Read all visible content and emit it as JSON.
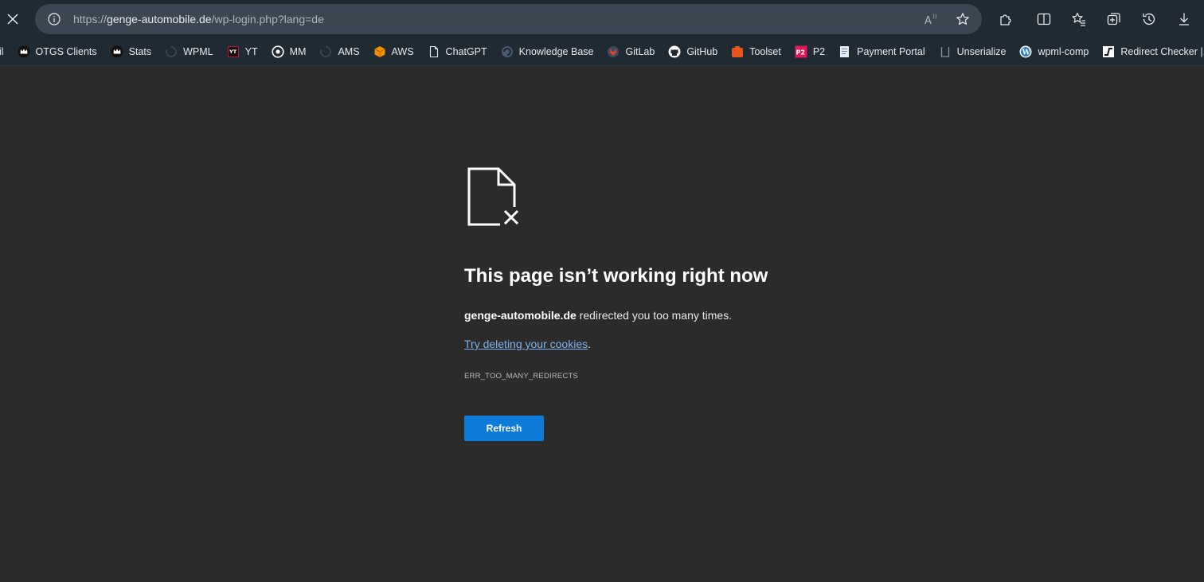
{
  "address_bar": {
    "url_host_prefix": "https://",
    "url_host": "genge-automobile.de",
    "url_path": "/wp-login.php?lang=de"
  },
  "bookmarks": [
    {
      "label": "ail",
      "icon": "mail-icon"
    },
    {
      "label": "OTGS Clients",
      "icon": "crown-icon"
    },
    {
      "label": "Stats",
      "icon": "crown-icon"
    },
    {
      "label": "WPML",
      "icon": "wpml-icon"
    },
    {
      "label": "YT",
      "icon": "yt-icon"
    },
    {
      "label": "MM",
      "icon": "mm-icon"
    },
    {
      "label": "AMS",
      "icon": "wpml-icon"
    },
    {
      "label": "AWS",
      "icon": "aws-cube-icon"
    },
    {
      "label": "ChatGPT",
      "icon": "page-icon"
    },
    {
      "label": "Knowledge Base",
      "icon": "kb-icon"
    },
    {
      "label": "GitLab",
      "icon": "gitlab-icon"
    },
    {
      "label": "GitHub",
      "icon": "github-icon"
    },
    {
      "label": "Toolset",
      "icon": "toolset-icon"
    },
    {
      "label": "P2",
      "icon": "p2-icon"
    },
    {
      "label": "Payment Portal",
      "icon": "doc-icon"
    },
    {
      "label": "Unserialize",
      "icon": "unserialize-icon"
    },
    {
      "label": "wpml-comp",
      "icon": "wordpress-icon"
    },
    {
      "label": "Redirect Checker |...",
      "icon": "redirect-icon"
    }
  ],
  "error": {
    "title": "This page isn’t working right now",
    "host": "genge-automobile.de",
    "message_rest": " redirected you too many times.",
    "tip_link": "Try deleting your cookies",
    "tip_suffix": ".",
    "code": "ERR_TOO_MANY_REDIRECTS",
    "refresh_label": "Refresh"
  },
  "colors": {
    "page_bg": "#2b2b2b",
    "chrome_bg": "#202a33",
    "addressbar_bg": "#3b4651",
    "link": "#7fb2f0",
    "button": "#0e7bd8"
  }
}
